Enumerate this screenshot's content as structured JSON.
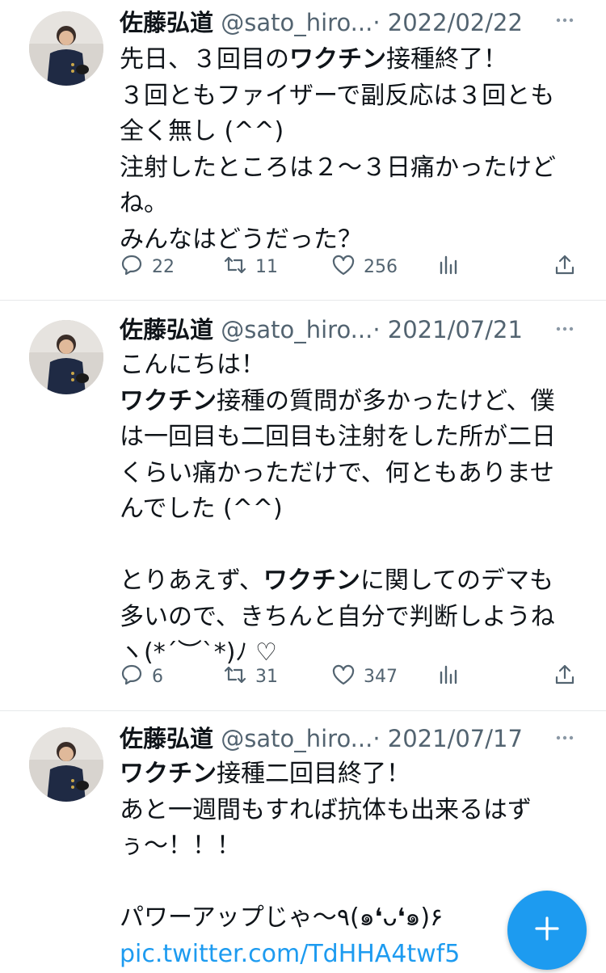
{
  "tweets": [
    {
      "name": "佐藤弘道",
      "handle": "@sato_hiro...",
      "dot": "·",
      "date": "2022/02/22",
      "lines": [
        [
          "先日、３回目の",
          "ワクチン",
          "接種終了！"
        ],
        [
          "３回ともファイザーで副反応は３回とも",
          "",
          ""
        ],
        [
          "全く無し (^^)",
          "",
          ""
        ],
        [
          "注射したところは２〜３日痛かったけど",
          "",
          ""
        ],
        [
          "ね。",
          "",
          ""
        ],
        [
          "みんなはどうだった？",
          "",
          ""
        ]
      ],
      "replies": "22",
      "retweets": "11",
      "likes": "256"
    },
    {
      "name": "佐藤弘道",
      "handle": "@sato_hiro...",
      "dot": "·",
      "date": "2021/07/21",
      "lines": [
        [
          "こんにちは！",
          "",
          ""
        ],
        [
          "",
          "ワクチン",
          "接種の質問が多かったけど、僕"
        ],
        [
          "は一回目も二回目も注射をした所が二日",
          "",
          ""
        ],
        [
          "くらい痛かっただけで、何ともありませ",
          "",
          ""
        ],
        [
          "んでした (^^)",
          "",
          ""
        ],
        [
          "",
          "",
          ""
        ],
        [
          "とりあえず、",
          "ワクチン",
          "に関してのデマも"
        ],
        [
          "多いので、きちんと自分で判断しようね",
          "",
          ""
        ],
        [
          "ヽ(*´︶`*)ﾉ ♡",
          "",
          ""
        ]
      ],
      "replies": "6",
      "retweets": "31",
      "likes": "347"
    },
    {
      "name": "佐藤弘道",
      "handle": "@sato_hiro...",
      "dot": "·",
      "date": "2021/07/17",
      "lines": [
        [
          "",
          "ワクチン",
          "接種二回目終了！"
        ],
        [
          "あと一週間もすれば抗体も出来るはず",
          "",
          ""
        ],
        [
          "ぅ〜！！！",
          "",
          ""
        ],
        [
          "",
          "",
          ""
        ],
        [
          "パワーアップじゃ〜٩(๑❛ᴗ❛๑)۶",
          "",
          ""
        ]
      ],
      "link": "pic.twitter.com/TdHHA4twf5"
    }
  ],
  "icons": [
    "reply-icon",
    "retweet-icon",
    "like-icon",
    "analytics-icon",
    "share-icon",
    "more-icon",
    "compose-icon"
  ],
  "colors": {
    "accent": "#1d9bf0",
    "muted": "#536471",
    "divider": "#e7e9ea"
  }
}
